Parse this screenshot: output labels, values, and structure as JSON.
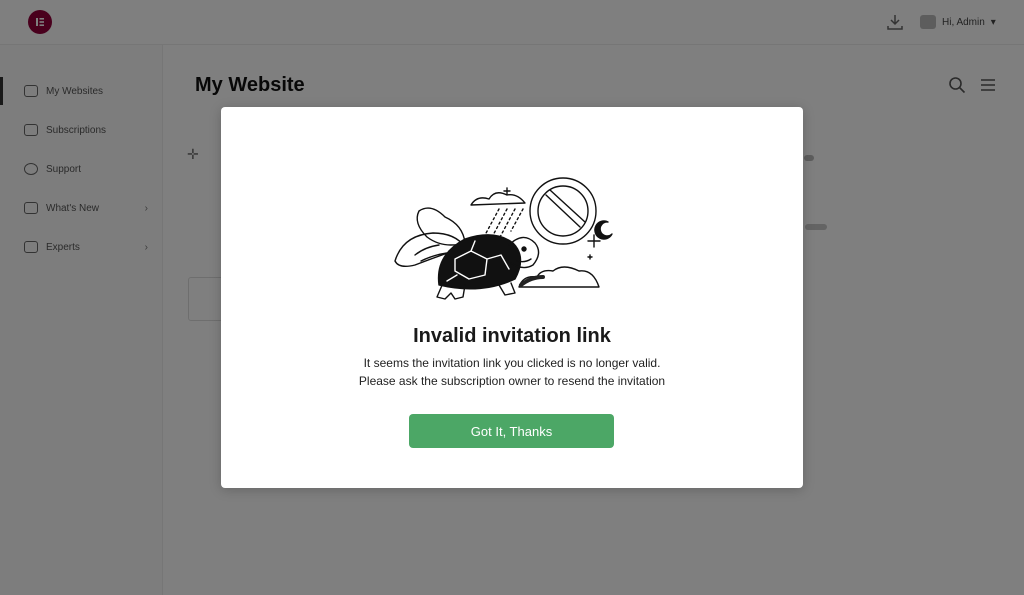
{
  "header": {
    "logo_icon": "elementor-logo-icon",
    "download_icon": "download-icon",
    "user_name": "Hi, Admin"
  },
  "sidebar": {
    "items": [
      {
        "label": "My Websites",
        "icon": "browser-icon"
      },
      {
        "label": "Subscriptions",
        "icon": "card-icon"
      },
      {
        "label": "Support",
        "icon": "help-icon"
      },
      {
        "label": "What's New",
        "icon": "share-icon"
      },
      {
        "label": "Experts",
        "icon": "people-icon"
      }
    ]
  },
  "main": {
    "title": "My Website"
  },
  "modal": {
    "title": "Invalid invitation link",
    "line1": "It seems the invitation link you clicked is no longer valid.",
    "line2": "Please ask the subscription owner to resend the invitation",
    "button": "Got It, Thanks",
    "illustration": "flying-turtle-no-entry-illustration",
    "button_color": "#4ca766",
    "overlay_color": "#000000"
  }
}
